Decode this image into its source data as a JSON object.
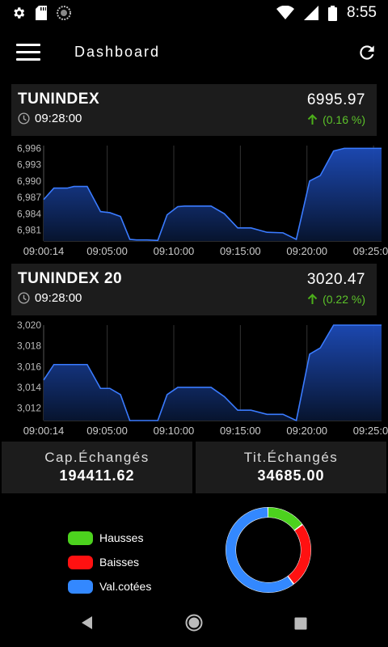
{
  "status_bar": {
    "time": "8:55",
    "icons": [
      "gear-icon",
      "sd-card-icon",
      "sync-circle-icon",
      "wifi-icon",
      "cell-signal-icon",
      "battery-icon"
    ]
  },
  "toolbar": {
    "title": "Dashboard",
    "menu_icon": "hamburger-menu-icon",
    "refresh_icon": "refresh-icon"
  },
  "indices": [
    {
      "name": "TUNINDEX",
      "time": "09:28:00",
      "value": "6995.97",
      "change": "(0.16 %)",
      "trend": "up"
    },
    {
      "name": "TUNINDEX 20",
      "time": "09:28:00",
      "value": "3020.47",
      "change": "(0.22 %)",
      "trend": "up"
    }
  ],
  "stats": {
    "cap_label": "Cap.Échangés",
    "cap_value": "194411.62",
    "tit_label": "Tit.Échangés",
    "tit_value": "34685.00"
  },
  "legend": {
    "items": [
      {
        "label": "Hausses",
        "color": "#4cd21e"
      },
      {
        "label": "Baisses",
        "color": "#ff1111"
      },
      {
        "label": "Val.cotées",
        "color": "#3388ff"
      }
    ]
  },
  "chart_data": [
    {
      "type": "area",
      "x_ticks": [
        "09:00:14",
        "09:05:00",
        "09:10:00",
        "09:15:00",
        "09:20:00",
        "09:25:00"
      ],
      "y_ticks": [
        "6,996",
        "6,993",
        "6,990",
        "6,987",
        "6,984",
        "6,981"
      ],
      "ylim": [
        6979,
        6996.5
      ],
      "xlim": [
        0.23,
        25.6
      ],
      "grid": "vertical",
      "color": "#3a7bff",
      "points": [
        [
          0.23,
          6986.6
        ],
        [
          1.0,
          6988.7
        ],
        [
          2.0,
          6988.7
        ],
        [
          2.5,
          6989.0
        ],
        [
          3.5,
          6989.0
        ],
        [
          4.5,
          6984.4
        ],
        [
          5.2,
          6984.2
        ],
        [
          6.0,
          6983.5
        ],
        [
          6.7,
          6979.3
        ],
        [
          7.2,
          6979.2
        ],
        [
          8.0,
          6979.2
        ],
        [
          8.8,
          6979.1
        ],
        [
          9.5,
          6983.8
        ],
        [
          10.3,
          6985.3
        ],
        [
          10.8,
          6985.4
        ],
        [
          12.8,
          6985.4
        ],
        [
          13.8,
          6984.0
        ],
        [
          14.8,
          6981.4
        ],
        [
          15.8,
          6981.4
        ],
        [
          17.0,
          6980.6
        ],
        [
          18.2,
          6980.5
        ],
        [
          19.2,
          6979.3
        ],
        [
          20.2,
          6990.0
        ],
        [
          21.0,
          6991.0
        ],
        [
          22.0,
          6995.5
        ],
        [
          22.8,
          6996.0
        ],
        [
          25.6,
          6996.0
        ]
      ]
    },
    {
      "type": "area",
      "x_ticks": [
        "09:00:14",
        "09:05:00",
        "09:10:00",
        "09:15:00",
        "09:20:00",
        "09:25:00"
      ],
      "y_ticks": [
        "3,020",
        "3,018",
        "3,016",
        "3,014",
        "3,012"
      ],
      "ylim": [
        3010.8,
        3020
      ],
      "xlim": [
        0.23,
        25.6
      ],
      "grid": "vertical",
      "color": "#3a7bff",
      "points": [
        [
          0.23,
          3014.7
        ],
        [
          1.0,
          3016.2
        ],
        [
          2.0,
          3016.2
        ],
        [
          3.0,
          3016.2
        ],
        [
          3.5,
          3016.2
        ],
        [
          4.5,
          3013.9
        ],
        [
          5.2,
          3013.9
        ],
        [
          6.0,
          3013.3
        ],
        [
          6.7,
          3010.8
        ],
        [
          8.8,
          3010.8
        ],
        [
          9.5,
          3013.3
        ],
        [
          10.3,
          3014.0
        ],
        [
          12.8,
          3014.0
        ],
        [
          13.8,
          3013.1
        ],
        [
          14.8,
          3011.8
        ],
        [
          15.8,
          3011.8
        ],
        [
          17.0,
          3011.4
        ],
        [
          18.2,
          3011.4
        ],
        [
          19.2,
          3010.8
        ],
        [
          20.2,
          3017.2
        ],
        [
          21.0,
          3017.8
        ],
        [
          22.0,
          3020.0
        ],
        [
          25.6,
          3020.0
        ]
      ]
    },
    {
      "type": "pie",
      "donut": true,
      "slices": [
        {
          "label": "Hausses",
          "value": 15,
          "color": "#4cd21e"
        },
        {
          "label": "Baisses",
          "value": 25,
          "color": "#ff1111"
        },
        {
          "label": "Val.cotées",
          "value": 60,
          "color": "#3388ff"
        }
      ]
    }
  ]
}
